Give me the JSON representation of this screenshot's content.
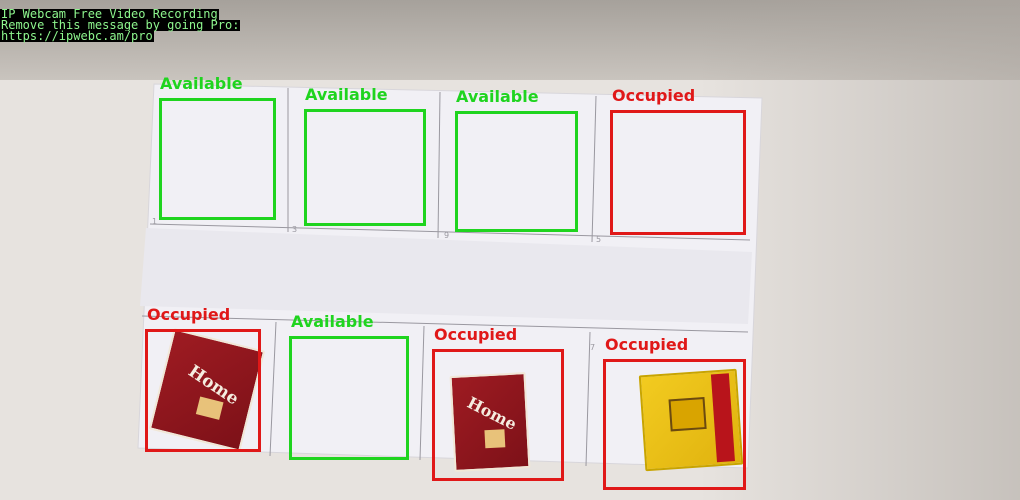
{
  "watermark": {
    "lines": [
      "IP Webcam Free Video Recording",
      "Remove this message by going Pro:",
      "https://ipwebc.am/pro"
    ]
  },
  "colors": {
    "available": "#1fd41f",
    "occupied": "#e01818",
    "paper": "#f1f0f5",
    "floor": "#e7e3df"
  },
  "slots": [
    {
      "label": "Available",
      "status": "available"
    },
    {
      "label": "Available",
      "status": "available"
    },
    {
      "label": "Available",
      "status": "available"
    },
    {
      "label": "Occupied",
      "status": "occupied"
    },
    {
      "label": "Occupied",
      "status": "occupied"
    },
    {
      "label": "Available",
      "status": "available"
    },
    {
      "label": "Occupied",
      "status": "occupied"
    },
    {
      "label": "Occupied",
      "status": "occupied"
    }
  ],
  "items": [
    {
      "name": "red-box",
      "brand": "Home"
    },
    {
      "name": "red-box",
      "brand": "Home"
    },
    {
      "name": "yellow-box",
      "brand": ""
    }
  ]
}
